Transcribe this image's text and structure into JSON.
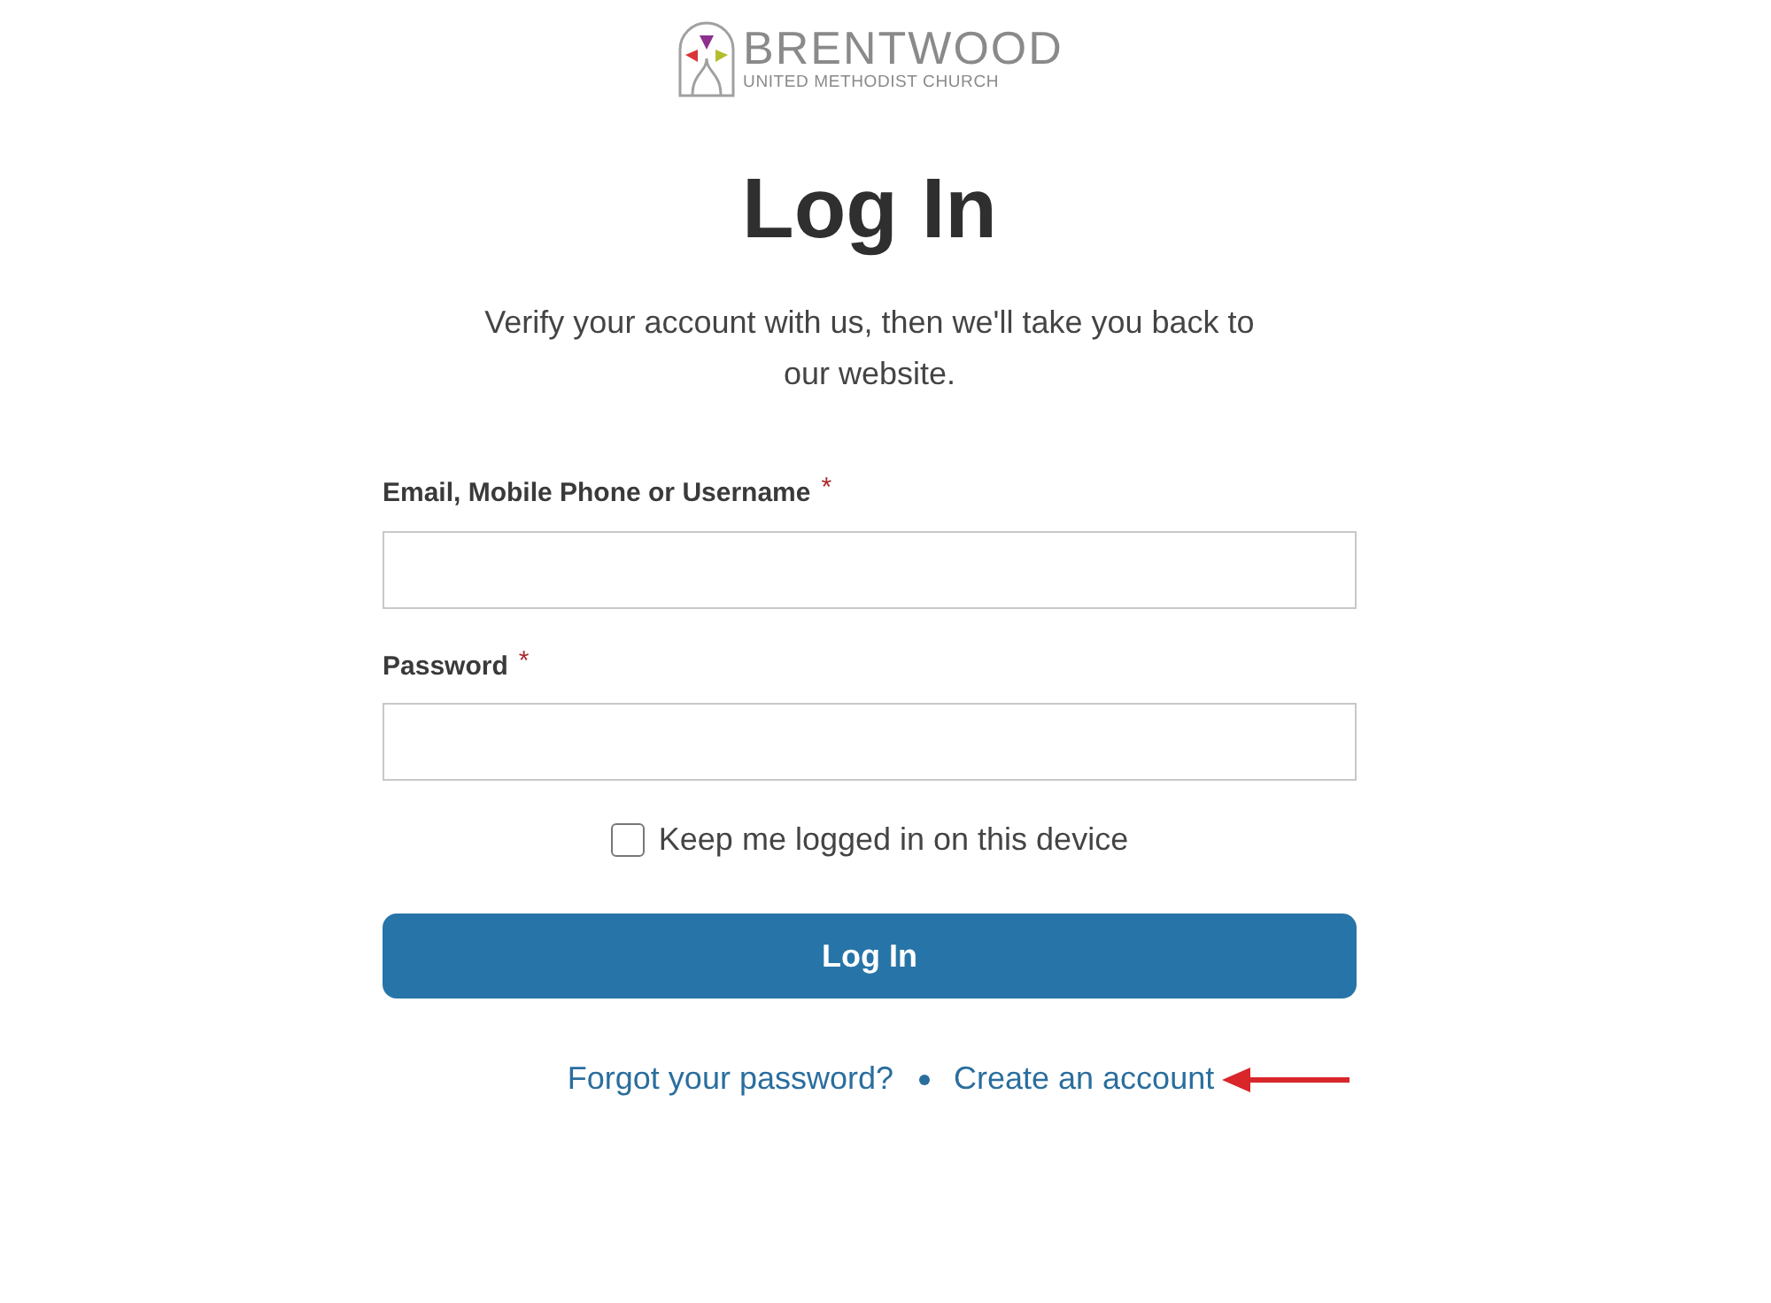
{
  "logo": {
    "name": "BRENTWOOD",
    "tagline": "UNITED METHODIST CHURCH"
  },
  "title": "Log In",
  "subtitle": "Verify your account with us, then we'll take you back to our website.",
  "fields": [
    {
      "label": "Email, Mobile Phone or Username",
      "required_mark": "*"
    },
    {
      "label": "Password",
      "required_mark": "*"
    }
  ],
  "remember": {
    "label": "Keep me logged in on this device",
    "checked": false
  },
  "submit": "Log In",
  "links": [
    {
      "label": "Forgot your password?",
      "annotated": false
    },
    {
      "label": "Create an account",
      "annotated": true
    }
  ]
}
